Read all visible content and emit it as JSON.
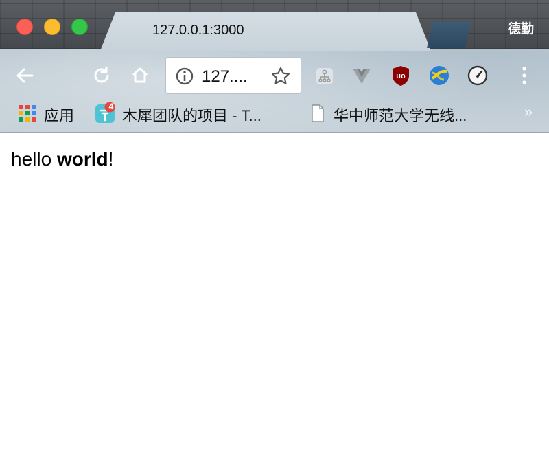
{
  "tab": {
    "title": "127.0.0.1:3000"
  },
  "profile": {
    "name": "德勤"
  },
  "omnibox": {
    "text": "127...."
  },
  "bookmarks": {
    "items": [
      {
        "label": "应用"
      },
      {
        "label": "木犀团队的项目 - T..."
      },
      {
        "label": "华中师范大学无线..."
      }
    ],
    "badge_count": "4",
    "overflow": "»"
  },
  "page": {
    "hello_plain": "hello ",
    "hello_bold": "world",
    "hello_end": "!"
  },
  "colors": {
    "close": "#fc5f57",
    "minimize": "#fdbc2e",
    "maximize": "#34c749",
    "ublock": "#8b0000"
  }
}
